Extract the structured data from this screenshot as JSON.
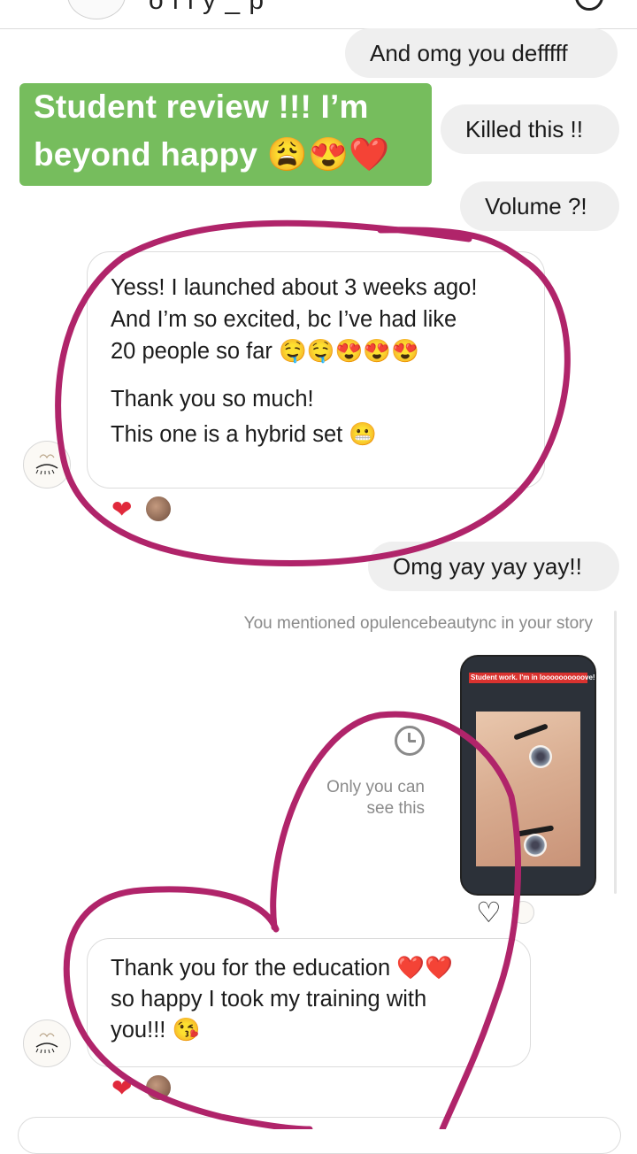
{
  "header": {
    "title": "o   l   l  y     _  p",
    "info_icon": "info-icon"
  },
  "story_banner": {
    "line1": "Student review !!! I’m",
    "line2": "beyond happy 😩😍❤️"
  },
  "messages_out": [
    "And omg you defffff",
    "Killed this !!",
    "Volume ?!",
    "Omg yay yay yay!!"
  ],
  "message_in_1": {
    "lines": [
      "Yess! I launched about 3 weeks ago!",
      "And I’m so excited, bc I’ve had like",
      "20 people so far 🤤🤤😍😍😍",
      "",
      "Thank you so much!",
      "This one is a hybrid set 😬"
    ],
    "reactions": [
      "heart-reaction",
      "face-reaction"
    ]
  },
  "system_note": "You mentioned opulencebeautync in your story",
  "story_reply": {
    "story_caption": "Student work. I'm in loooooooooove!",
    "expired_note_line1": "Only you can",
    "expired_note_line2": "see this"
  },
  "message_in_2": {
    "lines": [
      "Thank you for the education ❤️❤️",
      "so happy I took my training with",
      "you!!! 😘"
    ],
    "reactions": [
      "heart-reaction",
      "face-reaction"
    ]
  },
  "colors": {
    "banner_green": "#76bd5d",
    "outgoing_bubble": "#efefef",
    "annotation_magenta": "#b0246a",
    "heart_red": "#e0293b"
  }
}
